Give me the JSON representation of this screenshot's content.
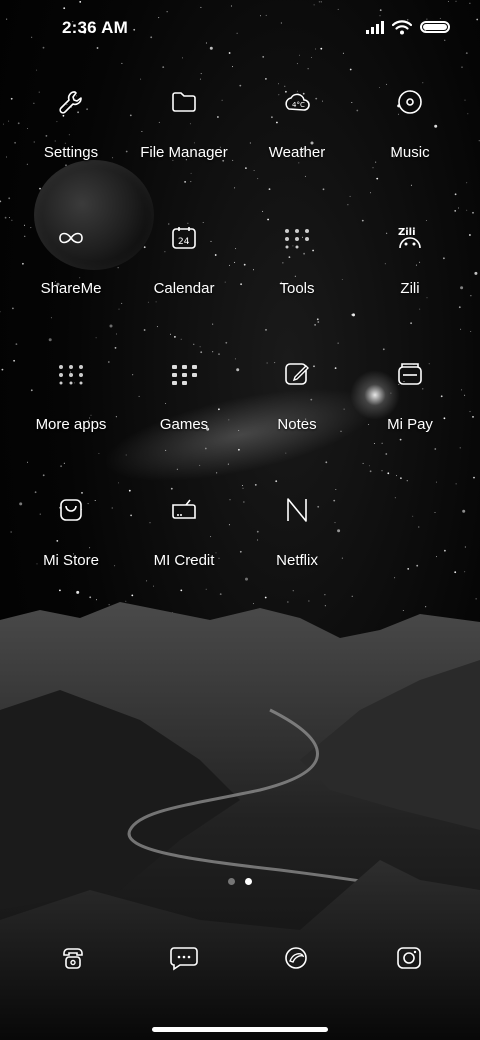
{
  "status_bar": {
    "time": "2:36 AM",
    "icons": [
      "signal-icon",
      "wifi-icon",
      "battery-icon"
    ]
  },
  "home": {
    "apps": [
      {
        "name": "settings",
        "label": "Settings",
        "icon": "wrench-icon"
      },
      {
        "name": "file-manager",
        "label": "File Manager",
        "icon": "folder-icon"
      },
      {
        "name": "weather",
        "label": "Weather",
        "icon": "weather-icon"
      },
      {
        "name": "music",
        "label": "Music",
        "icon": "disc-icon"
      },
      {
        "name": "shareme",
        "label": "ShareMe",
        "icon": "infinity-icon"
      },
      {
        "name": "calendar",
        "label": "Calendar",
        "icon": "calendar-icon",
        "badge": "24"
      },
      {
        "name": "tools",
        "label": "Tools",
        "icon": "folder-grid-icon"
      },
      {
        "name": "zili",
        "label": "Zili",
        "icon": "zili-icon",
        "badge": "Zili"
      },
      {
        "name": "more-apps",
        "label": "More apps",
        "icon": "folder-grid-icon"
      },
      {
        "name": "games",
        "label": "Games",
        "icon": "folder-grid-icon"
      },
      {
        "name": "notes",
        "label": "Notes",
        "icon": "note-edit-icon"
      },
      {
        "name": "mi-pay",
        "label": "Mi Pay",
        "icon": "wallet-icon"
      },
      {
        "name": "mi-store",
        "label": "Mi Store",
        "icon": "bag-icon"
      },
      {
        "name": "mi-credit",
        "label": "MI Credit",
        "icon": "credit-icon"
      },
      {
        "name": "netflix",
        "label": "Netflix",
        "icon": "netflix-n-icon"
      }
    ],
    "pages": {
      "count": 2,
      "active": 1
    }
  },
  "dock": [
    {
      "name": "phone",
      "icon": "phone-icon"
    },
    {
      "name": "messages",
      "icon": "message-icon"
    },
    {
      "name": "browser",
      "icon": "browser-icon"
    },
    {
      "name": "camera",
      "icon": "camera-icon"
    }
  ],
  "colors": {
    "foreground": "#ffffff",
    "background": "#000000"
  }
}
